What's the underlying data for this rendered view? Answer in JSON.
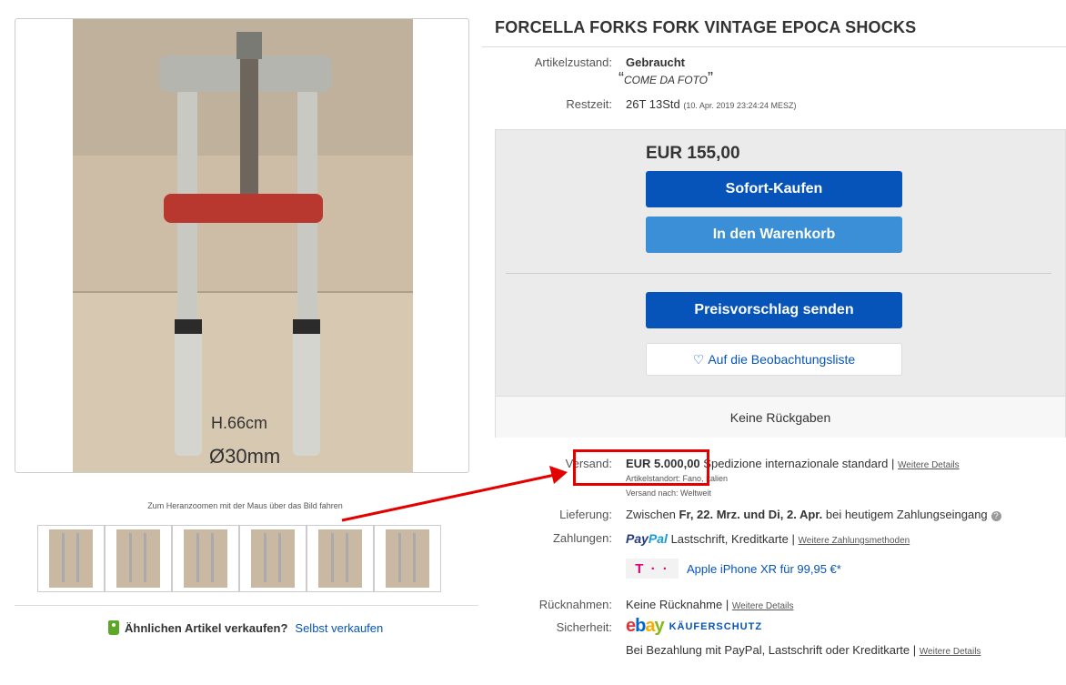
{
  "gallery": {
    "zoom_hint": "Zum Heranzoomen mit der Maus über das Bild fahren",
    "photo_text_1": "H.66cm",
    "photo_text_2": "Ø30mm",
    "thumb_count": 6
  },
  "sell_similar": {
    "question": "Ähnlichen Artikel verkaufen?",
    "link": "Selbst verkaufen"
  },
  "item": {
    "title": "FORCELLA FORKS FORK VINTAGE EPOCA SHOCKS",
    "condition_label": "Artikelzustand:",
    "condition_value": "Gebraucht",
    "condition_note": "COME DA FOTO",
    "time_label": "Restzeit:",
    "time_value": "26T 13Std",
    "time_end": "(10. Apr. 2019   23:24:24 MESZ)"
  },
  "buybox": {
    "price": "EUR 155,00",
    "buy_now": "Sofort-Kaufen",
    "add_to_cart": "In den Warenkorb",
    "make_offer": "Preisvorschlag senden",
    "watch": "Auf die Beobachtungsliste",
    "returns": "Keine Rückgaben"
  },
  "shipping": {
    "label": "Versand:",
    "price": "EUR 5.000,00",
    "service": "Spedizione internazionale standard",
    "sep": "|",
    "details_link": "Weitere Details",
    "location": "Artikelstandort:  Fano, Italien",
    "ships_to": "Versand nach:  Weltweit"
  },
  "delivery": {
    "label": "Lieferung:",
    "prefix": "Zwischen ",
    "dates": "Fr, 22. Mrz. und Di, 2. Apr.",
    "suffix": " bei heutigem Zahlungseingang"
  },
  "payment": {
    "label": "Zahlungen:",
    "paypal_1": "Pay",
    "paypal_2": "Pal",
    "methods": "Lastschrift,  Kreditkarte",
    "sep": "|",
    "more_link": "Weitere Zahlungsmethoden",
    "promo_logo": "T · ·",
    "promo_link": "Apple iPhone XR für 99,95 €*"
  },
  "returns": {
    "label": "Rücknahmen:",
    "value": "Keine Rücknahme",
    "sep": "|",
    "details_link": "Weitere Details"
  },
  "security": {
    "label": "Sicherheit:",
    "logo_e": "e",
    "logo_b": "b",
    "logo_a": "a",
    "logo_y": "y",
    "kaeuferschutz": "KÄUFERSCHUTZ",
    "text": "Bei Bezahlung mit PayPal, Lastschrift oder Kreditkarte",
    "sep": "|",
    "details_link": "Weitere Details"
  },
  "colors": {
    "primary_button": "#0654ba",
    "secondary_button": "#3a8fd6",
    "annotation": "#e50000"
  }
}
